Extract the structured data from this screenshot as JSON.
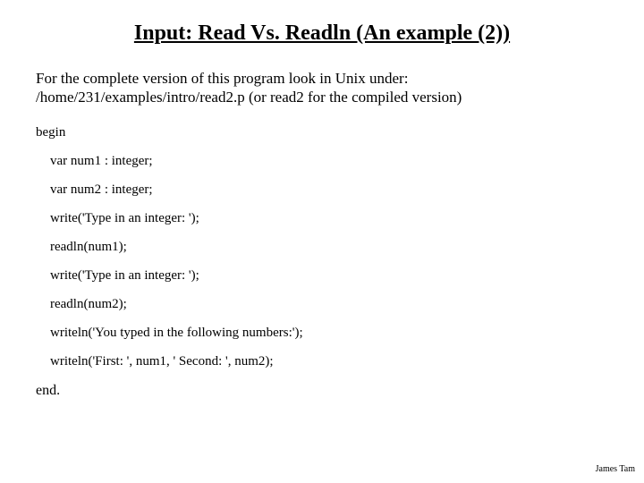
{
  "title": "Input: Read Vs. Readln (An example (2))",
  "intro_line1": "For the complete version of this program look in Unix under:",
  "intro_line2": "/home/231/examples/intro/read2.p (or read2 for the compiled version)",
  "code": {
    "begin": "begin",
    "l1": "var num1 : integer;",
    "l2": "var num2 : integer;",
    "l3": "write('Type in an integer: ');",
    "l4": "readln(num1);",
    "l5": "write('Type in an integer: ');",
    "l6": "readln(num2);",
    "l7": "writeln('You typed in the following numbers:');",
    "l8": "writeln('First: ', num1, '  Second: ', num2);",
    "end": "end."
  },
  "footer": "James Tam"
}
